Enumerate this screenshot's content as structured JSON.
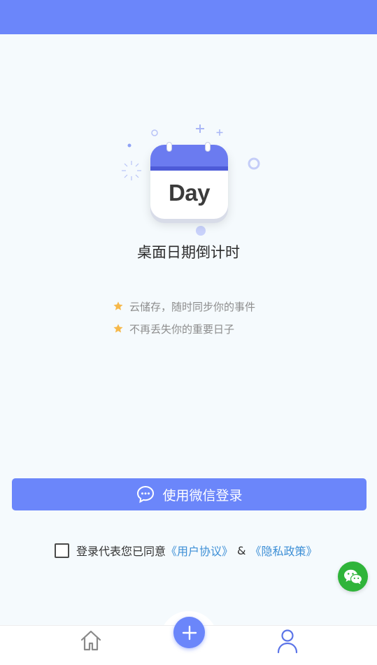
{
  "app": {
    "logo_text": "Day",
    "title": "桌面日期倒计时"
  },
  "features": [
    {
      "icon": "star-icon",
      "text": "云储存，随时同步你的事件"
    },
    {
      "icon": "star-icon",
      "text": "不再丢失你的重要日子"
    }
  ],
  "login": {
    "button_label": "使用微信登录",
    "icon": "chat-bubble-icon"
  },
  "agreement": {
    "prefix": "登录代表您已同意",
    "user_agreement": "《用户协议》",
    "separator": "&",
    "privacy_policy": "《隐私政策》",
    "checked": false
  },
  "tabbar": {
    "items": [
      {
        "name": "home",
        "icon": "home-icon"
      },
      {
        "name": "add",
        "icon": "plus-icon"
      },
      {
        "name": "profile",
        "icon": "user-icon"
      }
    ]
  },
  "colors": {
    "accent": "#6b86fa",
    "wechat_green": "#2fb43a",
    "link": "#3d8fd6",
    "star": "#f6b84a"
  }
}
